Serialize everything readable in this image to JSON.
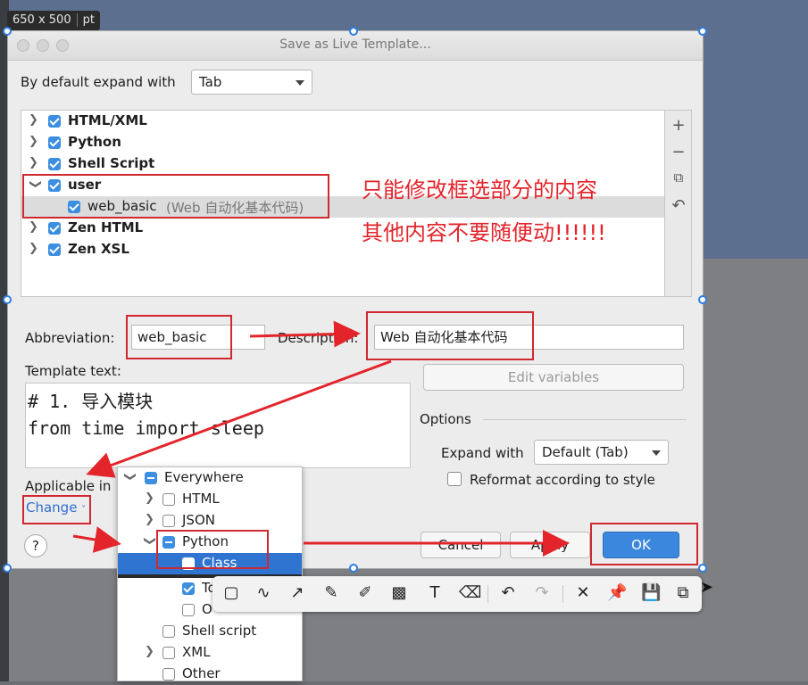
{
  "overlay": {
    "dimensions": "650 x 500",
    "unit": "pt"
  },
  "dialog": {
    "title": "Save as Live Template...",
    "expand_label": "By default expand with",
    "expand_value": "Tab",
    "tree": [
      {
        "label": "HTML/XML",
        "checked": true
      },
      {
        "label": "Python",
        "checked": true
      },
      {
        "label": "Shell Script",
        "checked": true
      },
      {
        "label": "user",
        "checked": true,
        "expanded": true
      },
      {
        "label": "web_basic",
        "note": "(Web 自动化基本代码)",
        "checked": true,
        "selected": true
      },
      {
        "label": "Zen HTML",
        "checked": true
      },
      {
        "label": "Zen XSL",
        "checked": true
      }
    ],
    "tools": {
      "add": "+",
      "remove": "−",
      "copy": "⧉",
      "revert": "↶"
    },
    "annotation_line1": "只能修改框选部分的内容",
    "annotation_line2": "其他内容不要随便动!!!!!!",
    "abbreviation_label": "Abbreviation:",
    "abbreviation_value": "web_basic",
    "description_label": "Description:",
    "description_value": "Web 自动化基本代码",
    "template_label": "Template text:",
    "template_line1": "# 1. 导入模块",
    "template_line2": "from time import sleep",
    "edit_variables": "Edit variables",
    "options_label": "Options",
    "expand_with_label": "Expand with",
    "expand_with_value": "Default (Tab)",
    "reformat_label": "Reformat according to style",
    "applicable_label": "Applicable in",
    "change_label": "Change",
    "help": "?",
    "cancel": "Cancel",
    "apply": "Apply",
    "ok": "OK"
  },
  "popup": {
    "items": [
      {
        "label": "Everywhere",
        "state": "partial"
      },
      {
        "label": "HTML",
        "state": "off"
      },
      {
        "label": "JSON",
        "state": "off"
      },
      {
        "label": "Python",
        "state": "partial"
      },
      {
        "label": "Class",
        "state": "on"
      },
      {
        "label": "To",
        "state": "on"
      },
      {
        "label": "O",
        "state": "off"
      },
      {
        "label": "Shell script",
        "state": "off"
      },
      {
        "label": "XML",
        "state": "off"
      },
      {
        "label": "Other",
        "state": "off"
      }
    ]
  },
  "colors": {
    "accent": "#3b8ee0",
    "annotation_red": "#e3242b",
    "selection": "#2f74d0",
    "ok_button": "#3a87dd"
  }
}
